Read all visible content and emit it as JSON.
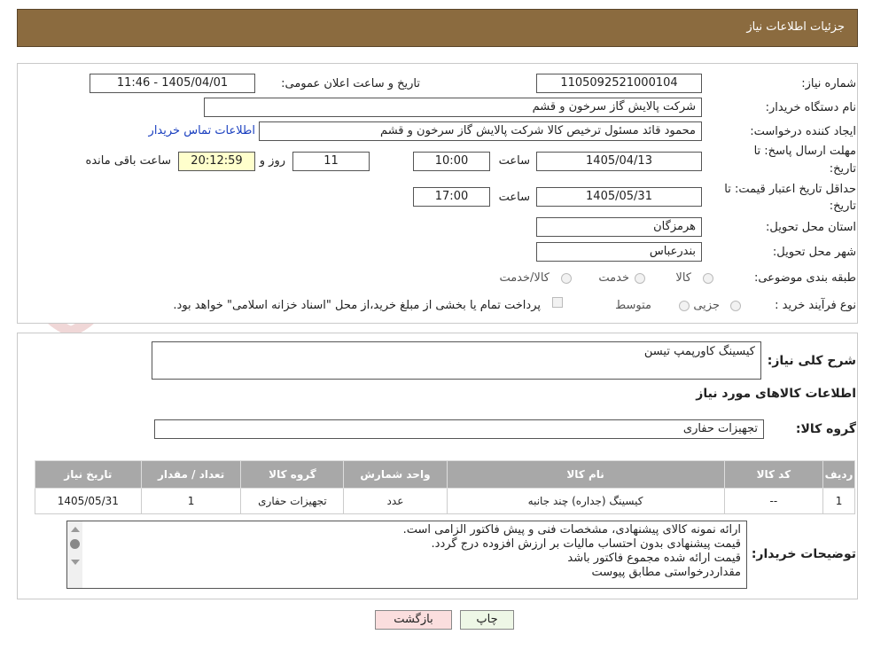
{
  "header": {
    "title": "جزئیات اطلاعات نیاز"
  },
  "form": {
    "need_number_label": "شماره نیاز:",
    "need_number": "1105092521000104",
    "announce_datetime_label": "تاریخ و ساعت اعلان عمومی:",
    "announce_datetime": "1405/04/01 - 11:46",
    "buyer_org_label": "نام دستگاه خریدار:",
    "buyer_org": "شرکت پالایش گاز سرخون و قشم",
    "requester_label": "ایجاد کننده درخواست:",
    "requester": "محمود قائد مسئول ترخیص کالا شرکت پالایش گاز سرخون و قشم",
    "buyer_contact_link": "اطلاعات تماس خریدار",
    "deadline_label_1": "مهلت ارسال پاسخ: تا",
    "deadline_label_2": "تاریخ:",
    "deadline_date": "1405/04/13",
    "time_label": "ساعت",
    "deadline_time": "10:00",
    "days_left": "11",
    "days_label": "روز و",
    "remaining_time": "20:12:59",
    "remaining_label": "ساعت باقی مانده",
    "validity_label_1": "حداقل تاریخ اعتبار قیمت: تا",
    "validity_label_2": "تاریخ:",
    "validity_date": "1405/05/31",
    "validity_time": "17:00",
    "province_label": "استان محل تحویل:",
    "province": "هرمزگان",
    "city_label": "شهر محل تحویل:",
    "city": "بندرعباس",
    "category_label": "طبقه بندی موضوعی:",
    "category_options": [
      "کالا",
      "خدمت",
      "کالا/خدمت"
    ],
    "process_label": "نوع فرآیند خرید :",
    "process_options": [
      "جزیی",
      "متوسط"
    ],
    "payment_note": "پرداخت تمام یا بخشی از مبلغ خرید،از محل \"اسناد خزانه اسلامی\" خواهد بود."
  },
  "details": {
    "summary_label": "شرح کلی نیاز:",
    "summary": "کیسینگ کاورپمپ تیسن",
    "goods_info_title": "اطلاعات کالاهای مورد نیاز",
    "goods_group_label": "گروه کالا:",
    "goods_group": "تجهیزات حفاری",
    "table": {
      "headers": [
        "ردیف",
        "کد کالا",
        "نام کالا",
        "واحد شمارش",
        "گروه کالا",
        "تعداد / مقدار",
        "تاریخ نیاز"
      ],
      "rows": [
        [
          "1",
          "--",
          "کیسینگ (جداره) چند جانبه",
          "عدد",
          "تجهیزات حفاری",
          "1",
          "1405/05/31"
        ]
      ]
    },
    "buyer_notes_label": "توضیحات خریدار:",
    "buyer_notes": [
      "ارائه نمونه کالای پیشنهادی، مشخصات فنی و پیش فاکتور الزامی است.",
      "قیمت پیشنهادی بدون احتساب مالیات بر ارزش افزوده درج گردد.",
      "قیمت ارائه شده مجموع فاکتور باشد",
      "مقداردرخواستی مطابق پیوست"
    ]
  },
  "buttons": {
    "print": "چاپ",
    "back": "بازگشت"
  },
  "watermark": {
    "text": "AriaTender.neT"
  },
  "colors": {
    "header": "#8b6b3f",
    "link": "#1a3fbf",
    "table_header": "#a8a8a8",
    "back_button": "#fbdede"
  }
}
